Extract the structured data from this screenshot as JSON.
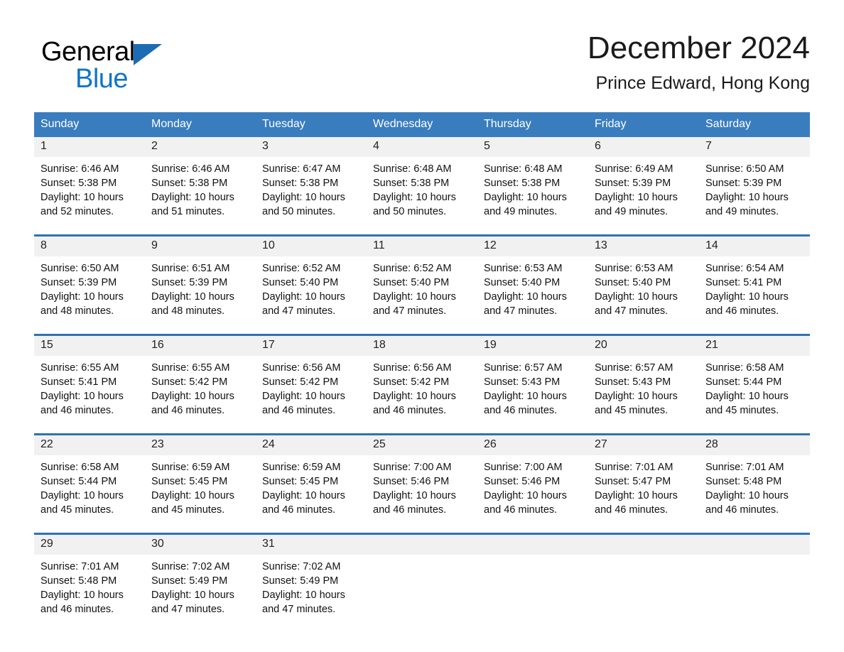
{
  "brand": {
    "name_part1": "General",
    "name_part2": "Blue",
    "logo_icon": "blue-triangle-icon"
  },
  "header": {
    "month_title": "December 2024",
    "location": "Prince Edward, Hong Kong"
  },
  "colors": {
    "header_blue": "#3a7dbe",
    "row_divider_blue": "#2f72b0",
    "brand_blue": "#1275c4",
    "daynum_strip": "#f1f1f1"
  },
  "calendar": {
    "weekday_headers": [
      "Sunday",
      "Monday",
      "Tuesday",
      "Wednesday",
      "Thursday",
      "Friday",
      "Saturday"
    ],
    "weeks": [
      {
        "days": [
          {
            "date": "1",
            "sunrise": "Sunrise: 6:46 AM",
            "sunset": "Sunset: 5:38 PM",
            "daylight": "Daylight: 10 hours and 52 minutes."
          },
          {
            "date": "2",
            "sunrise": "Sunrise: 6:46 AM",
            "sunset": "Sunset: 5:38 PM",
            "daylight": "Daylight: 10 hours and 51 minutes."
          },
          {
            "date": "3",
            "sunrise": "Sunrise: 6:47 AM",
            "sunset": "Sunset: 5:38 PM",
            "daylight": "Daylight: 10 hours and 50 minutes."
          },
          {
            "date": "4",
            "sunrise": "Sunrise: 6:48 AM",
            "sunset": "Sunset: 5:38 PM",
            "daylight": "Daylight: 10 hours and 50 minutes."
          },
          {
            "date": "5",
            "sunrise": "Sunrise: 6:48 AM",
            "sunset": "Sunset: 5:38 PM",
            "daylight": "Daylight: 10 hours and 49 minutes."
          },
          {
            "date": "6",
            "sunrise": "Sunrise: 6:49 AM",
            "sunset": "Sunset: 5:39 PM",
            "daylight": "Daylight: 10 hours and 49 minutes."
          },
          {
            "date": "7",
            "sunrise": "Sunrise: 6:50 AM",
            "sunset": "Sunset: 5:39 PM",
            "daylight": "Daylight: 10 hours and 49 minutes."
          }
        ]
      },
      {
        "days": [
          {
            "date": "8",
            "sunrise": "Sunrise: 6:50 AM",
            "sunset": "Sunset: 5:39 PM",
            "daylight": "Daylight: 10 hours and 48 minutes."
          },
          {
            "date": "9",
            "sunrise": "Sunrise: 6:51 AM",
            "sunset": "Sunset: 5:39 PM",
            "daylight": "Daylight: 10 hours and 48 minutes."
          },
          {
            "date": "10",
            "sunrise": "Sunrise: 6:52 AM",
            "sunset": "Sunset: 5:40 PM",
            "daylight": "Daylight: 10 hours and 47 minutes."
          },
          {
            "date": "11",
            "sunrise": "Sunrise: 6:52 AM",
            "sunset": "Sunset: 5:40 PM",
            "daylight": "Daylight: 10 hours and 47 minutes."
          },
          {
            "date": "12",
            "sunrise": "Sunrise: 6:53 AM",
            "sunset": "Sunset: 5:40 PM",
            "daylight": "Daylight: 10 hours and 47 minutes."
          },
          {
            "date": "13",
            "sunrise": "Sunrise: 6:53 AM",
            "sunset": "Sunset: 5:40 PM",
            "daylight": "Daylight: 10 hours and 47 minutes."
          },
          {
            "date": "14",
            "sunrise": "Sunrise: 6:54 AM",
            "sunset": "Sunset: 5:41 PM",
            "daylight": "Daylight: 10 hours and 46 minutes."
          }
        ]
      },
      {
        "days": [
          {
            "date": "15",
            "sunrise": "Sunrise: 6:55 AM",
            "sunset": "Sunset: 5:41 PM",
            "daylight": "Daylight: 10 hours and 46 minutes."
          },
          {
            "date": "16",
            "sunrise": "Sunrise: 6:55 AM",
            "sunset": "Sunset: 5:42 PM",
            "daylight": "Daylight: 10 hours and 46 minutes."
          },
          {
            "date": "17",
            "sunrise": "Sunrise: 6:56 AM",
            "sunset": "Sunset: 5:42 PM",
            "daylight": "Daylight: 10 hours and 46 minutes."
          },
          {
            "date": "18",
            "sunrise": "Sunrise: 6:56 AM",
            "sunset": "Sunset: 5:42 PM",
            "daylight": "Daylight: 10 hours and 46 minutes."
          },
          {
            "date": "19",
            "sunrise": "Sunrise: 6:57 AM",
            "sunset": "Sunset: 5:43 PM",
            "daylight": "Daylight: 10 hours and 46 minutes."
          },
          {
            "date": "20",
            "sunrise": "Sunrise: 6:57 AM",
            "sunset": "Sunset: 5:43 PM",
            "daylight": "Daylight: 10 hours and 45 minutes."
          },
          {
            "date": "21",
            "sunrise": "Sunrise: 6:58 AM",
            "sunset": "Sunset: 5:44 PM",
            "daylight": "Daylight: 10 hours and 45 minutes."
          }
        ]
      },
      {
        "days": [
          {
            "date": "22",
            "sunrise": "Sunrise: 6:58 AM",
            "sunset": "Sunset: 5:44 PM",
            "daylight": "Daylight: 10 hours and 45 minutes."
          },
          {
            "date": "23",
            "sunrise": "Sunrise: 6:59 AM",
            "sunset": "Sunset: 5:45 PM",
            "daylight": "Daylight: 10 hours and 45 minutes."
          },
          {
            "date": "24",
            "sunrise": "Sunrise: 6:59 AM",
            "sunset": "Sunset: 5:45 PM",
            "daylight": "Daylight: 10 hours and 46 minutes."
          },
          {
            "date": "25",
            "sunrise": "Sunrise: 7:00 AM",
            "sunset": "Sunset: 5:46 PM",
            "daylight": "Daylight: 10 hours and 46 minutes."
          },
          {
            "date": "26",
            "sunrise": "Sunrise: 7:00 AM",
            "sunset": "Sunset: 5:46 PM",
            "daylight": "Daylight: 10 hours and 46 minutes."
          },
          {
            "date": "27",
            "sunrise": "Sunrise: 7:01 AM",
            "sunset": "Sunset: 5:47 PM",
            "daylight": "Daylight: 10 hours and 46 minutes."
          },
          {
            "date": "28",
            "sunrise": "Sunrise: 7:01 AM",
            "sunset": "Sunset: 5:48 PM",
            "daylight": "Daylight: 10 hours and 46 minutes."
          }
        ]
      },
      {
        "days": [
          {
            "date": "29",
            "sunrise": "Sunrise: 7:01 AM",
            "sunset": "Sunset: 5:48 PM",
            "daylight": "Daylight: 10 hours and 46 minutes."
          },
          {
            "date": "30",
            "sunrise": "Sunrise: 7:02 AM",
            "sunset": "Sunset: 5:49 PM",
            "daylight": "Daylight: 10 hours and 47 minutes."
          },
          {
            "date": "31",
            "sunrise": "Sunrise: 7:02 AM",
            "sunset": "Sunset: 5:49 PM",
            "daylight": "Daylight: 10 hours and 47 minutes."
          },
          {
            "date": "",
            "sunrise": "",
            "sunset": "",
            "daylight": ""
          },
          {
            "date": "",
            "sunrise": "",
            "sunset": "",
            "daylight": ""
          },
          {
            "date": "",
            "sunrise": "",
            "sunset": "",
            "daylight": ""
          },
          {
            "date": "",
            "sunrise": "",
            "sunset": "",
            "daylight": ""
          }
        ]
      }
    ]
  }
}
